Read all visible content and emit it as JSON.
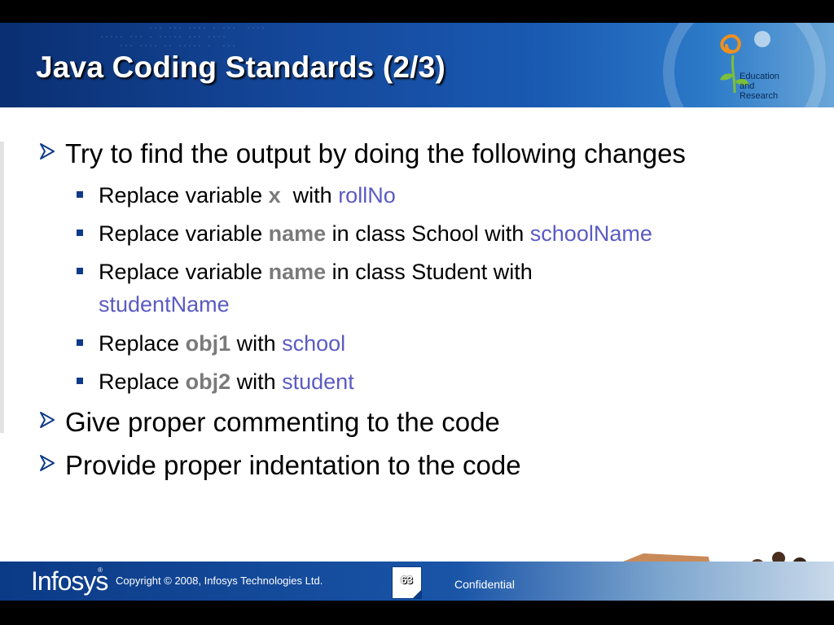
{
  "slide": {
    "title": "Java Coding Standards (2/3)",
    "logo": {
      "label_line1": "Education",
      "label_line2": "and",
      "label_line3": "Research",
      "colors": {
        "orange": "#f0901e",
        "green": "#7cbf3a",
        "dark": "#0b2a55"
      }
    },
    "bullets": {
      "b1": "Try to find the output by doing the following changes",
      "sub": [
        {
          "pre": "Replace variable ",
          "kw": "x",
          "mid": "  with ",
          "new": "rollNo"
        },
        {
          "pre": "Replace variable ",
          "kw": "name",
          "mid": " in class School with ",
          "new": "schoolName"
        },
        {
          "pre": "Replace variable ",
          "kw": "name",
          "mid": " in class Student with ",
          "new": "studentName"
        },
        {
          "pre": "Replace ",
          "kw": "obj1",
          "mid": " with ",
          "new": "school"
        },
        {
          "pre": "Replace ",
          "kw": "obj2",
          "mid": " with ",
          "new": "student"
        }
      ],
      "b2": "Give proper commenting to the code",
      "b3": "Provide proper indentation to the code"
    },
    "colors": {
      "keyword": "#7a7a7a",
      "new_name": "#5b5bc2",
      "bullet": "#0f3a8a",
      "banner": "#14479a"
    }
  },
  "footer": {
    "brand": "Infosys",
    "registered": "®",
    "copyright": "Copyright © 2008, Infosys Technologies Ltd.",
    "page_number": "63",
    "confidential": "Confidential"
  }
}
